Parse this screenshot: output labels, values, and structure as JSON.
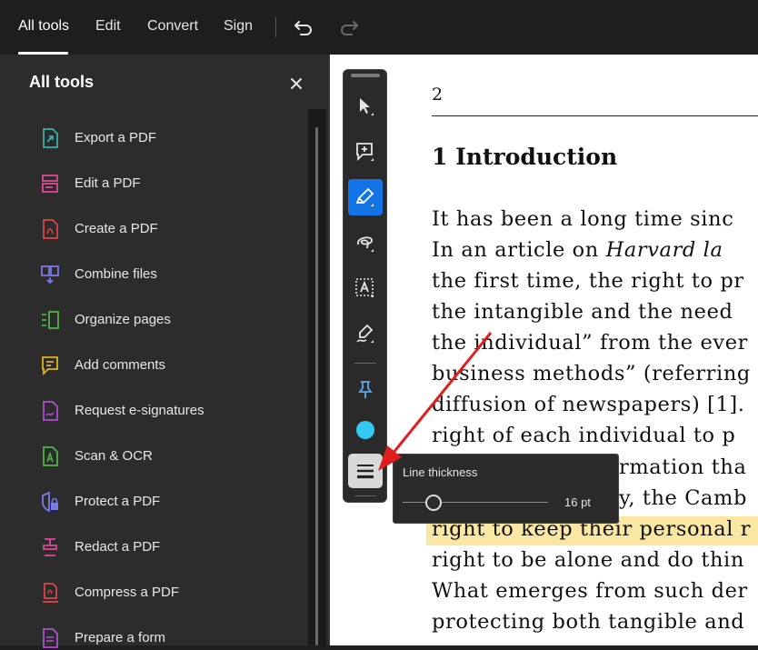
{
  "topbar": {
    "tabs": [
      {
        "label": "All tools"
      },
      {
        "label": "Edit"
      },
      {
        "label": "Convert"
      },
      {
        "label": "Sign"
      }
    ]
  },
  "panel": {
    "title": "All tools",
    "items": [
      {
        "label": "Export a PDF",
        "icon": "export-pdf-icon",
        "color": "#3bb0a6"
      },
      {
        "label": "Edit a PDF",
        "icon": "edit-pdf-icon",
        "color": "#e2489a"
      },
      {
        "label": "Create a PDF",
        "icon": "create-pdf-icon",
        "color": "#e0444a"
      },
      {
        "label": "Combine files",
        "icon": "combine-files-icon",
        "color": "#7a7be8"
      },
      {
        "label": "Organize pages",
        "icon": "organize-pages-icon",
        "color": "#4fb548"
      },
      {
        "label": "Add comments",
        "icon": "add-comments-icon",
        "color": "#e3b21a"
      },
      {
        "label": "Request e-signatures",
        "icon": "request-esignature-icon",
        "color": "#b04fd0"
      },
      {
        "label": "Scan & OCR",
        "icon": "scan-ocr-icon",
        "color": "#4fb548"
      },
      {
        "label": "Protect a PDF",
        "icon": "protect-pdf-icon",
        "color": "#7a7be8"
      },
      {
        "label": "Redact a PDF",
        "icon": "redact-pdf-icon",
        "color": "#e2489a"
      },
      {
        "label": "Compress a PDF",
        "icon": "compress-pdf-icon",
        "color": "#e0444a"
      },
      {
        "label": "Prepare a form",
        "icon": "prepare-form-icon",
        "color": "#b04fd0"
      }
    ]
  },
  "toolbar": {
    "tools": [
      "select-icon",
      "add-comment-icon",
      "highlight-icon",
      "draw-icon",
      "text-select-icon",
      "sign-icon",
      "pin-icon"
    ],
    "selected_color": "#33c9f3"
  },
  "tooltip": {
    "title": "Line thickness",
    "value": "16 pt",
    "slider_fraction": 0.2
  },
  "document": {
    "page_number": "2",
    "heading": "1 Introduction",
    "lines": [
      "It has been a long time sinc",
      "In an article on |Harvard la|",
      "the first time, the right to pr",
      "the intangible and the need",
      "the individual” from the ever",
      "business methods” (referring",
      "diffusion of newspapers) [1].",
      "right of each individual to p",
      "rmation tha",
      "y, the Camb",
      "right to keep their personal r",
      "right to be alone and do thin",
      "What emerges from such der",
      "protecting both tangible and"
    ]
  }
}
